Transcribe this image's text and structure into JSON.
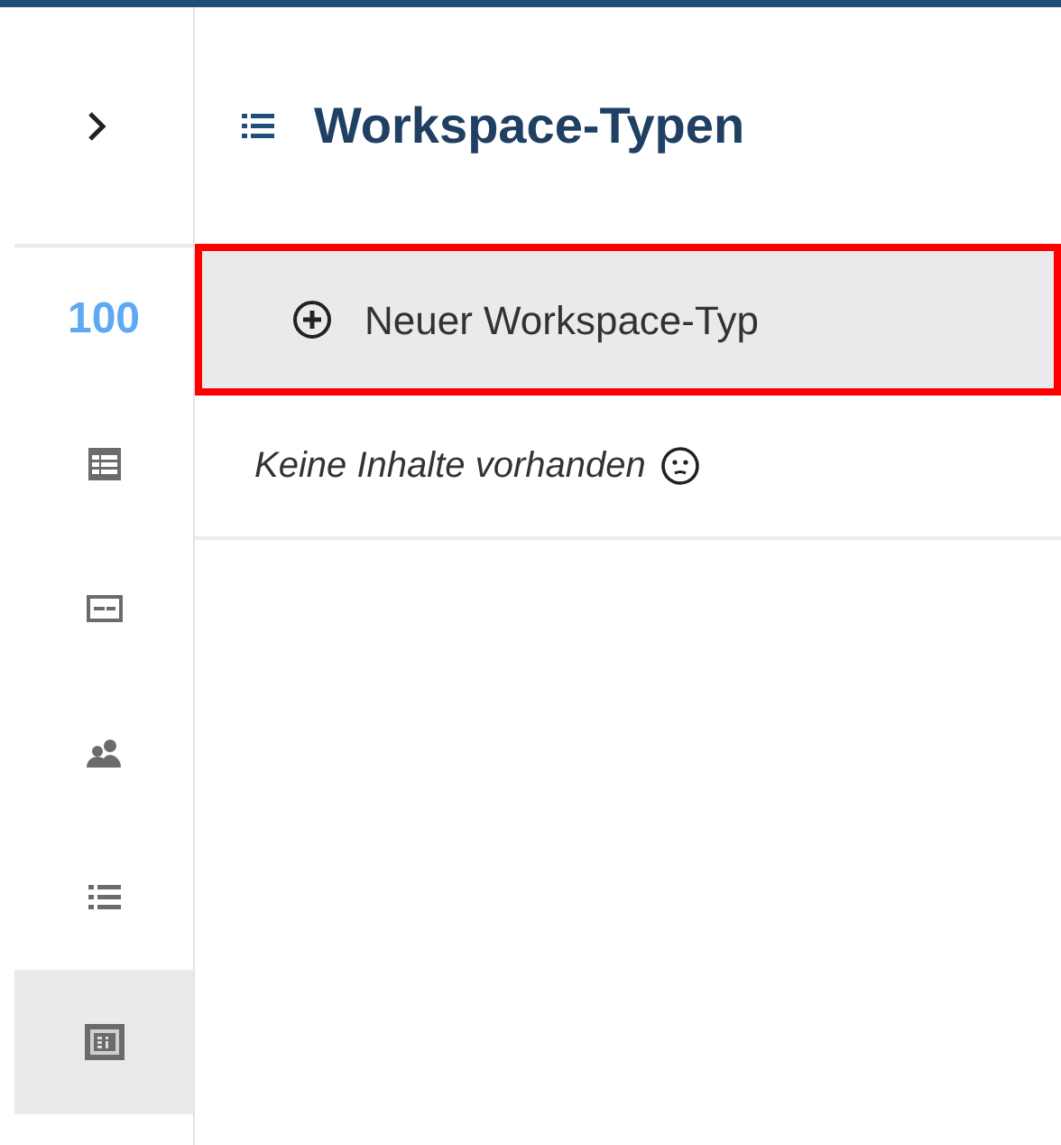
{
  "sidebar": {
    "items": [
      {
        "kind": "count",
        "label": "100",
        "selected": false
      },
      {
        "kind": "table",
        "selected": false
      },
      {
        "kind": "card",
        "selected": false
      },
      {
        "kind": "users",
        "selected": false
      },
      {
        "kind": "list",
        "selected": false
      },
      {
        "kind": "info",
        "selected": true
      }
    ]
  },
  "main": {
    "title": "Workspace-Typen",
    "new_button": {
      "label": "Neuer Workspace-Typ",
      "highlighted": true
    },
    "empty_text": "Keine Inhalte vorhanden"
  }
}
